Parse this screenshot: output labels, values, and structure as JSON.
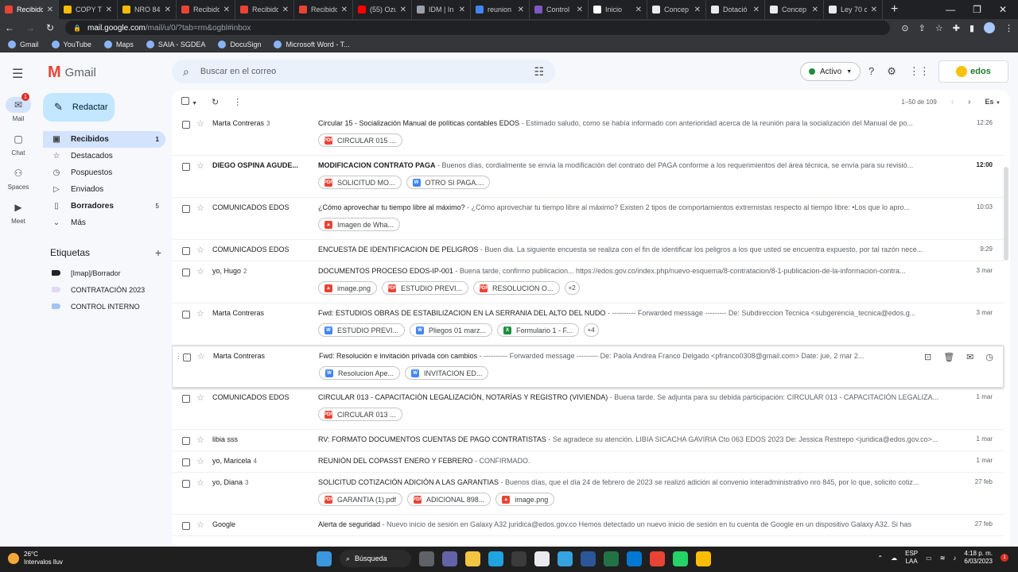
{
  "browser": {
    "tabs": [
      {
        "title": "Recibido",
        "favicon_color": "#ea4335",
        "active": true
      },
      {
        "title": "COPY TE",
        "favicon_color": "#fbbc04",
        "active": false
      },
      {
        "title": "NRO 84",
        "favicon_color": "#fbbc04",
        "active": false
      },
      {
        "title": "Recibido",
        "favicon_color": "#ea4335",
        "active": false
      },
      {
        "title": "Recibido",
        "favicon_color": "#ea4335",
        "active": false
      },
      {
        "title": "Recibido",
        "favicon_color": "#ea4335",
        "active": false
      },
      {
        "title": "(55) Ozu",
        "favicon_color": "#ff0000",
        "active": false
      },
      {
        "title": "IDM | In",
        "favicon_color": "#9aa0a6",
        "active": false
      },
      {
        "title": "reunion",
        "favicon_color": "#4285f4",
        "active": false
      },
      {
        "title": "Control",
        "favicon_color": "#7e57c2",
        "active": false
      },
      {
        "title": "Inicio",
        "favicon_color": "#ffffff",
        "active": false
      },
      {
        "title": "Concep",
        "favicon_color": "#e8eaed",
        "active": false
      },
      {
        "title": "Dotació",
        "favicon_color": "#e8eaed",
        "active": false
      },
      {
        "title": "Concep",
        "favicon_color": "#e8eaed",
        "active": false
      },
      {
        "title": "Ley 70 c",
        "favicon_color": "#e8eaed",
        "active": false
      }
    ],
    "url_host": "mail.google.com",
    "url_path": "/mail/u/0/?tab=rm&ogbl#inbox",
    "bookmarks": [
      "Gmail",
      "YouTube",
      "Maps",
      "SAIA - SGDEA",
      "DocuSign",
      "Microsoft Word - T..."
    ]
  },
  "gmail": {
    "logo_text": "Gmail",
    "rail": [
      {
        "label": "Mail",
        "icon": "mail-icon",
        "badge": "1",
        "active": true
      },
      {
        "label": "Chat",
        "icon": "chat-icon",
        "badge": "",
        "active": false
      },
      {
        "label": "Spaces",
        "icon": "spaces-icon",
        "badge": "",
        "active": false
      },
      {
        "label": "Meet",
        "icon": "meet-icon",
        "badge": "",
        "active": false
      }
    ],
    "search_placeholder": "Buscar en el correo",
    "status": "Activo",
    "org_logo_text": "edos",
    "compose_label": "Redactar",
    "nav": [
      {
        "label": "Recibidos",
        "icon": "inbox-icon",
        "count": "1",
        "active": true,
        "bold": true
      },
      {
        "label": "Destacados",
        "icon": "star-icon",
        "count": "",
        "active": false,
        "bold": false
      },
      {
        "label": "Pospuestos",
        "icon": "clock-icon",
        "count": "",
        "active": false,
        "bold": false
      },
      {
        "label": "Enviados",
        "icon": "send-icon",
        "count": "",
        "active": false,
        "bold": false
      },
      {
        "label": "Borradores",
        "icon": "draft-icon",
        "count": "5",
        "active": false,
        "bold": true
      },
      {
        "label": "Más",
        "icon": "chevron-down-icon",
        "count": "",
        "active": false,
        "bold": false
      }
    ],
    "labels_title": "Etiquetas",
    "labels": [
      {
        "name": "[Imap]/Borrador",
        "color": "#202124"
      },
      {
        "name": "CONTRATACIÓN 2023",
        "color": "#e4d7f5"
      },
      {
        "name": "CONTROL INTERNO",
        "color": "#a4c2f4"
      }
    ],
    "toolbar": {
      "range": "1–50 de 109",
      "lang": "Es"
    },
    "emails": [
      {
        "sender": "Marta Contreras",
        "count": "3",
        "subject": "Circular 15 - Socialización Manual de políticas contables EDOS",
        "snippet": " - Estimado saludo, como se había informado con anterioridad acerca de la reunión para la socialización del Manual de po...",
        "time": "12:26",
        "unread": false,
        "attachments": [
          {
            "name": "CIRCULAR 015 ...",
            "type": "pdf"
          }
        ]
      },
      {
        "sender": "DIEGO OSPINA AGUDE...",
        "count": "",
        "subject": "MODIFICACION CONTRATO PAGA",
        "snippet": " - Buenos días, cordialmente se envía la modificación del contrato del PAGA conforme a los requerimientos del área técnica, se envía para su revisió...",
        "time": "12:00",
        "unread": true,
        "attachments": [
          {
            "name": "SOLICITUD MO...",
            "type": "pdf"
          },
          {
            "name": "OTRO SI PAGA....",
            "type": "doc"
          }
        ]
      },
      {
        "sender": "COMUNICADOS EDOS",
        "count": "",
        "subject": "¿Cómo aprovechar tu tiempo libre al máximo?",
        "snippet": " - ¿Cómo aprovechar tu tiempo libre al máximo? Existen 2 tipos de comportamientos extremistas respecto al tiempo libre: •Los que lo apro...",
        "time": "10:03",
        "unread": false,
        "attachments": [
          {
            "name": "Imagen de Wha...",
            "type": "img"
          }
        ]
      },
      {
        "sender": "COMUNICADOS EDOS",
        "count": "",
        "subject": "ENCUESTA DE IDENTIFICACION DE PELIGROS",
        "snippet": " - Buen dia. La siguiente encuesta se realiza con el fin de identificar los peligros a los que usted se encuentra expuesto, por tal razón nece...",
        "time": "9:29",
        "unread": false,
        "attachments": []
      },
      {
        "sender": "yo, Hugo",
        "count": "2",
        "subject": "DOCUMENTOS PROCESO EDOS-IP-001",
        "snippet": " - Buena tarde, confirmo publicacion... https://edos.gov.co/index.php/nuevo-esquema/8-contratacion/8-1-publicacion-de-la-informacion-contra...",
        "time": "3 mar",
        "unread": false,
        "attachments": [
          {
            "name": "image.png",
            "type": "img"
          },
          {
            "name": "ESTUDIO PREVI...",
            "type": "pdf"
          },
          {
            "name": "RESOLUCION O...",
            "type": "pdf"
          }
        ],
        "more": "+2"
      },
      {
        "sender": "Marta Contreras",
        "count": "",
        "subject": "Fwd: ESTUDIOS OBRAS DE ESTABILIZACION EN LA SERRANIA DEL ALTO DEL NUDO",
        "snippet": " - ---------- Forwarded message --------- De: Subdireccion Tecnica <subgerencia_tecnica@edos.g...",
        "time": "3 mar",
        "unread": false,
        "attachments": [
          {
            "name": "ESTUDIO PREVI...",
            "type": "doc"
          },
          {
            "name": "Pliegos 01 marz...",
            "type": "doc"
          },
          {
            "name": "Formulario 1 - F...",
            "type": "xls"
          }
        ],
        "more": "+4"
      },
      {
        "sender": "Marta Contreras",
        "count": "",
        "subject": "Fwd: Resolución e invitación privada con cambios",
        "snippet": " - ---------- Forwarded message --------- De: Paola Andrea Franco Delgado <pfranco0308@gmail.com> Date: jue, 2 mar 2...",
        "time": "",
        "unread": false,
        "hover": true,
        "attachments": [
          {
            "name": "Resolucion Ape...",
            "type": "doc"
          },
          {
            "name": "INVITACION ED...",
            "type": "doc"
          }
        ]
      },
      {
        "sender": "COMUNICADOS EDOS",
        "count": "",
        "subject": "CIRCULAR 013 - CAPACITACIÓN LEGALIZACIÓN, NOTARÍAS Y REGISTRO (VIVIENDA)",
        "snippet": " - Buena tarde. Se adjunta para su debida participación: CIRCULAR 013 - CAPACITACIÓN LEGALIZA...",
        "time": "1 mar",
        "unread": false,
        "attachments": [
          {
            "name": "CIRCULAR 013 ...",
            "type": "pdf"
          }
        ]
      },
      {
        "sender": "libia sss",
        "count": "",
        "subject": "RV: FORMATO DOCUMENTOS CUENTAS DE PAGO CONTRATISTAS",
        "snippet": " - Se agradece su atención. LIBIA SICACHA GAVIRIA Cto 063 EDOS 2023 De: Jessica Restrepo <juridica@edos.gov.co>...",
        "time": "1 mar",
        "unread": false,
        "attachments": []
      },
      {
        "sender": "yo, Maricela",
        "count": "4",
        "subject": "REUNIÓN DEL COPASST ENERO Y FEBRERO",
        "snippet": " - CONFIRMADO.",
        "time": "1 mar",
        "unread": false,
        "attachments": []
      },
      {
        "sender": "yo, Diana",
        "count": "3",
        "subject": "SOLICITUD COTIZACIÓN ADICIÓN A LAS GARANTIAS",
        "snippet": " - Buenos días, que el día 24 de febrero de 2023 se realizó adición al convenio interadministrativo nro 845, por lo que, solicito cotiz...",
        "time": "27 feb",
        "unread": false,
        "attachments": [
          {
            "name": "GARANTIA (1).pdf",
            "type": "pdf"
          },
          {
            "name": "ADICIONAL 898...",
            "type": "pdf"
          },
          {
            "name": "image.png",
            "type": "img"
          }
        ]
      },
      {
        "sender": "Google",
        "count": "",
        "subject": "Alerta de seguridad",
        "snippet": " - Nuevo inicio de sesión en Galaxy A32 juridica@edos.gov.co Hemos detectado un nuevo inicio de sesión en tu cuenta de Google en un dispositivo Galaxy A32. Si has",
        "time": "27 feb",
        "unread": false,
        "attachments": []
      }
    ]
  },
  "taskbar": {
    "weather_temp": "26°C",
    "weather_desc": "Intervalos lluv",
    "weather_badge": "1",
    "search_label": "Búsqueda",
    "apps": [
      {
        "name": "start-icon",
        "color": "#3a96dd"
      },
      {
        "name": "task-view-icon",
        "color": "#5f6368"
      },
      {
        "name": "teams-icon",
        "color": "#6264a7"
      },
      {
        "name": "file-explorer-icon",
        "color": "#f4c542"
      },
      {
        "name": "edge-icon",
        "color": "#1fa3e1"
      },
      {
        "name": "store-icon",
        "color": "#3c3c3c"
      },
      {
        "name": "threads-icon",
        "color": "#e8eaed"
      },
      {
        "name": "app-icon",
        "color": "#35a3e0"
      },
      {
        "name": "word-icon",
        "color": "#2b579a"
      },
      {
        "name": "excel-icon",
        "color": "#217346"
      },
      {
        "name": "outlook-icon",
        "color": "#0078d4"
      },
      {
        "name": "chrome-icon",
        "color": "#ea4335"
      },
      {
        "name": "whatsapp-icon",
        "color": "#25d366"
      },
      {
        "name": "chrome-alt-icon",
        "color": "#fbbc04"
      }
    ],
    "tray_lang_1": "ESP",
    "tray_lang_2": "LAA",
    "time": "4:18 p. m.",
    "date": "6/03/2023",
    "notification_count": "1"
  }
}
